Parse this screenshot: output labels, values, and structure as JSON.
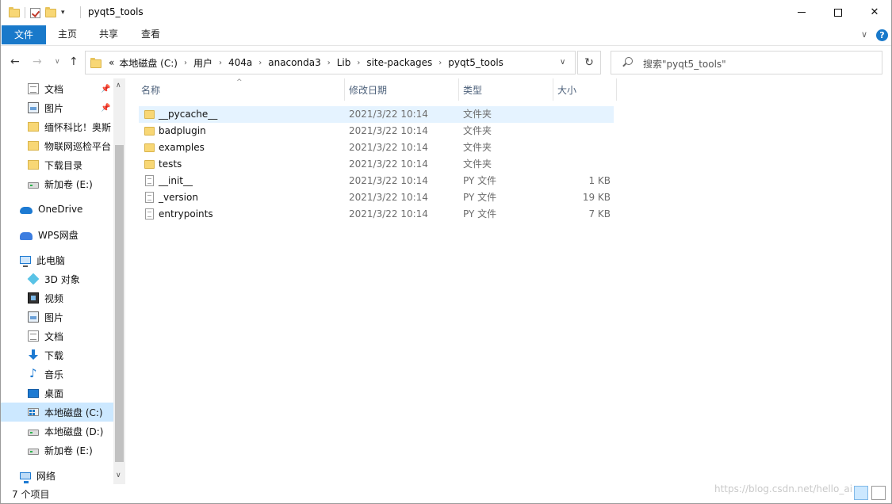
{
  "window": {
    "title": "pyqt5_tools",
    "controls": {
      "minimize": "minimize",
      "maximize": "maximize",
      "close": "✕"
    }
  },
  "ribbon": {
    "tabs": [
      "文件",
      "主页",
      "共享",
      "查看"
    ],
    "help": "?"
  },
  "nav": {
    "back": "←",
    "forward": "→",
    "up": "↑",
    "overflow": "«",
    "breadcrumb": [
      "本地磁盘 (C:)",
      "用户",
      "404a",
      "anaconda3",
      "Lib",
      "site-packages",
      "pyqt5_tools"
    ],
    "refresh": "↻",
    "search_placeholder": "搜索\"pyqt5_tools\""
  },
  "sidebar": {
    "items": [
      {
        "label": "文档",
        "icon": "document-icon",
        "pinned": true
      },
      {
        "label": "图片",
        "icon": "picture-icon",
        "pinned": true
      },
      {
        "label": "缅怀科比！奥斯",
        "icon": "folder-icon",
        "pinned": false
      },
      {
        "label": "物联网巡检平台",
        "icon": "folder-icon",
        "pinned": false
      },
      {
        "label": "下载目录",
        "icon": "folder-icon",
        "pinned": false
      },
      {
        "label": "新加卷 (E:)",
        "icon": "drive-icon",
        "pinned": false
      },
      {
        "label": "OneDrive",
        "icon": "onedrive-icon",
        "pinned": false
      },
      {
        "label": "WPS网盘",
        "icon": "wps-cloud-icon",
        "pinned": false
      },
      {
        "label": "此电脑",
        "icon": "this-pc-icon",
        "pinned": false
      },
      {
        "label": "3D 对象",
        "icon": "3d-objects-icon",
        "pinned": false
      },
      {
        "label": "视频",
        "icon": "video-icon",
        "pinned": false
      },
      {
        "label": "图片",
        "icon": "picture-icon",
        "pinned": false
      },
      {
        "label": "文档",
        "icon": "document-icon",
        "pinned": false
      },
      {
        "label": "下载",
        "icon": "download-icon",
        "pinned": false
      },
      {
        "label": "音乐",
        "icon": "music-icon",
        "pinned": false
      },
      {
        "label": "桌面",
        "icon": "desktop-icon",
        "pinned": false
      },
      {
        "label": "本地磁盘 (C:)",
        "icon": "windows-drive-icon",
        "pinned": false,
        "selected": true
      },
      {
        "label": "本地磁盘 (D:)",
        "icon": "drive-icon",
        "pinned": false
      },
      {
        "label": "新加卷 (E:)",
        "icon": "drive-icon",
        "pinned": false
      },
      {
        "label": "网络",
        "icon": "network-icon",
        "pinned": false
      }
    ]
  },
  "columns": {
    "name": "名称",
    "date": "修改日期",
    "type": "类型",
    "size": "大小"
  },
  "files": [
    {
      "name": "__pycache__",
      "date": "2021/3/22 10:14",
      "type": "文件夹",
      "size": "",
      "kind": "folder"
    },
    {
      "name": "badplugin",
      "date": "2021/3/22 10:14",
      "type": "文件夹",
      "size": "",
      "kind": "folder"
    },
    {
      "name": "examples",
      "date": "2021/3/22 10:14",
      "type": "文件夹",
      "size": "",
      "kind": "folder"
    },
    {
      "name": "tests",
      "date": "2021/3/22 10:14",
      "type": "文件夹",
      "size": "",
      "kind": "folder"
    },
    {
      "name": "__init__",
      "date": "2021/3/22 10:14",
      "type": "PY 文件",
      "size": "1 KB",
      "kind": "file"
    },
    {
      "name": "_version",
      "date": "2021/3/22 10:14",
      "type": "PY 文件",
      "size": "19 KB",
      "kind": "file"
    },
    {
      "name": "entrypoints",
      "date": "2021/3/22 10:14",
      "type": "PY 文件",
      "size": "7 KB",
      "kind": "file"
    }
  ],
  "status": {
    "count": "7 个项目"
  },
  "watermark": "https://blog.csdn.net/hello_ai",
  "colors": {
    "accent": "#1979ca",
    "selection": "#cce8ff",
    "hover": "#e5f3ff"
  }
}
